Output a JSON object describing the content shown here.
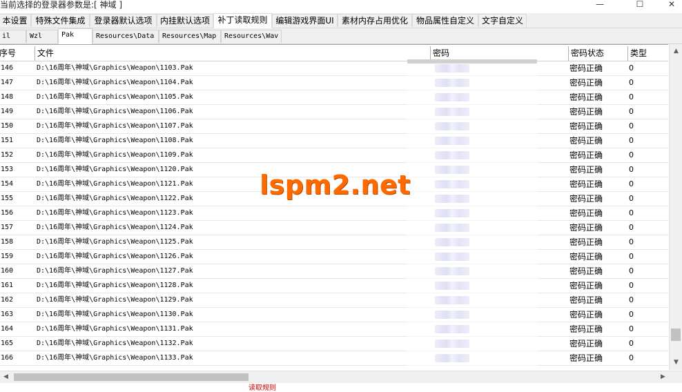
{
  "window": {
    "title": "当前选择的登录器参数是:[ 神域 ]",
    "minimize_glyph": "—",
    "maximize_glyph": "☐",
    "close_glyph": "✕"
  },
  "main_tabs": [
    {
      "label": "本设置",
      "active": false
    },
    {
      "label": "特殊文件集成",
      "active": false
    },
    {
      "label": "登录器默认选项",
      "active": false
    },
    {
      "label": "内挂默认选项",
      "active": false
    },
    {
      "label": "补丁读取规则",
      "active": true
    },
    {
      "label": "编辑游戏界面UI",
      "active": false
    },
    {
      "label": "素材内存占用优化",
      "active": false
    },
    {
      "label": "物品属性自定义",
      "active": false
    },
    {
      "label": "文字自定义",
      "active": false
    }
  ],
  "sub_tabs": [
    {
      "label": "il",
      "active": false
    },
    {
      "label": "Wzl",
      "active": false
    },
    {
      "label": "Pak",
      "active": true
    },
    {
      "label": "Resources\\Data",
      "active": false
    },
    {
      "label": "Resources\\Map",
      "active": false
    },
    {
      "label": "Resources\\Wav",
      "active": false
    }
  ],
  "columns": {
    "num": "序号",
    "file": "文件",
    "password": "密码",
    "status": "密码状态",
    "type": "类型"
  },
  "rows": [
    {
      "num": "146",
      "file": "D:\\16周年\\神域\\Graphics\\Weapon\\1103.Pak",
      "status": "密码正确",
      "type": "0"
    },
    {
      "num": "147",
      "file": "D:\\16周年\\神域\\Graphics\\Weapon\\1104.Pak",
      "status": "密码正确",
      "type": "0"
    },
    {
      "num": "148",
      "file": "D:\\16周年\\神域\\Graphics\\Weapon\\1105.Pak",
      "status": "密码正确",
      "type": "0"
    },
    {
      "num": "149",
      "file": "D:\\16周年\\神域\\Graphics\\Weapon\\1106.Pak",
      "status": "密码正确",
      "type": "0"
    },
    {
      "num": "150",
      "file": "D:\\16周年\\神域\\Graphics\\Weapon\\1107.Pak",
      "status": "密码正确",
      "type": "0"
    },
    {
      "num": "151",
      "file": "D:\\16周年\\神域\\Graphics\\Weapon\\1108.Pak",
      "status": "密码正确",
      "type": "0"
    },
    {
      "num": "152",
      "file": "D:\\16周年\\神域\\Graphics\\Weapon\\1109.Pak",
      "status": "密码正确",
      "type": "0"
    },
    {
      "num": "153",
      "file": "D:\\16周年\\神域\\Graphics\\Weapon\\1120.Pak",
      "status": "密码正确",
      "type": "0"
    },
    {
      "num": "154",
      "file": "D:\\16周年\\神域\\Graphics\\Weapon\\1121.Pak",
      "status": "密码正确",
      "type": "0"
    },
    {
      "num": "155",
      "file": "D:\\16周年\\神域\\Graphics\\Weapon\\1122.Pak",
      "status": "密码正确",
      "type": "0"
    },
    {
      "num": "156",
      "file": "D:\\16周年\\神域\\Graphics\\Weapon\\1123.Pak",
      "status": "密码正确",
      "type": "0"
    },
    {
      "num": "157",
      "file": "D:\\16周年\\神域\\Graphics\\Weapon\\1124.Pak",
      "status": "密码正确",
      "type": "0"
    },
    {
      "num": "158",
      "file": "D:\\16周年\\神域\\Graphics\\Weapon\\1125.Pak",
      "status": "密码正确",
      "type": "0"
    },
    {
      "num": "159",
      "file": "D:\\16周年\\神域\\Graphics\\Weapon\\1126.Pak",
      "status": "密码正确",
      "type": "0"
    },
    {
      "num": "160",
      "file": "D:\\16周年\\神域\\Graphics\\Weapon\\1127.Pak",
      "status": "密码正确",
      "type": "0"
    },
    {
      "num": "161",
      "file": "D:\\16周年\\神域\\Graphics\\Weapon\\1128.Pak",
      "status": "密码正确",
      "type": "0"
    },
    {
      "num": "162",
      "file": "D:\\16周年\\神域\\Graphics\\Weapon\\1129.Pak",
      "status": "密码正确",
      "type": "0"
    },
    {
      "num": "163",
      "file": "D:\\16周年\\神域\\Graphics\\Weapon\\1130.Pak",
      "status": "密码正确",
      "type": "0"
    },
    {
      "num": "164",
      "file": "D:\\16周年\\神域\\Graphics\\Weapon\\1131.Pak",
      "status": "密码正确",
      "type": "0"
    },
    {
      "num": "165",
      "file": "D:\\16周年\\神域\\Graphics\\Weapon\\1132.Pak",
      "status": "密码正确",
      "type": "0"
    },
    {
      "num": "166",
      "file": "D:\\16周年\\神域\\Graphics\\Weapon\\1133.Pak",
      "status": "密码正确",
      "type": "0"
    }
  ],
  "watermark": "lspm2.net",
  "status_text": "读取规则",
  "icons": {
    "scroll_up": "▲",
    "scroll_down": "▼",
    "scroll_left": "◀",
    "scroll_right": "▶"
  }
}
